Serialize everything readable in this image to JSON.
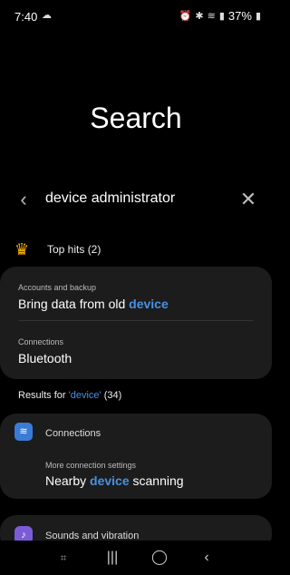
{
  "status_bar": {
    "time": "7:40",
    "battery": "37%"
  },
  "page": {
    "title": "Search"
  },
  "search": {
    "query": "device administrator"
  },
  "top_hits": {
    "label": "Top hits (2)",
    "items": [
      {
        "category": "Accounts and backup",
        "title_pre": "Bring data from old ",
        "title_hl": "device",
        "title_post": ""
      },
      {
        "category": "Connections",
        "title_pre": "Bluetooth",
        "title_hl": "",
        "title_post": ""
      }
    ]
  },
  "results": {
    "prefix": "Results for ",
    "query": "'device'",
    "count": " (34)"
  },
  "sections": [
    {
      "label": "Connections",
      "sub_category": "More connection settings",
      "title_pre": "Nearby ",
      "title_hl": "device",
      "title_post": " scanning"
    },
    {
      "label": "Sounds and vibration"
    }
  ],
  "icons": {
    "back": "chevron-left-icon",
    "clear": "close-icon",
    "crown": "crown-icon",
    "wifi": "wifi-icon",
    "sound": "speaker-icon"
  },
  "colors": {
    "highlight": "#4a90e2",
    "card": "#1c1c1c",
    "background": "#000000"
  }
}
